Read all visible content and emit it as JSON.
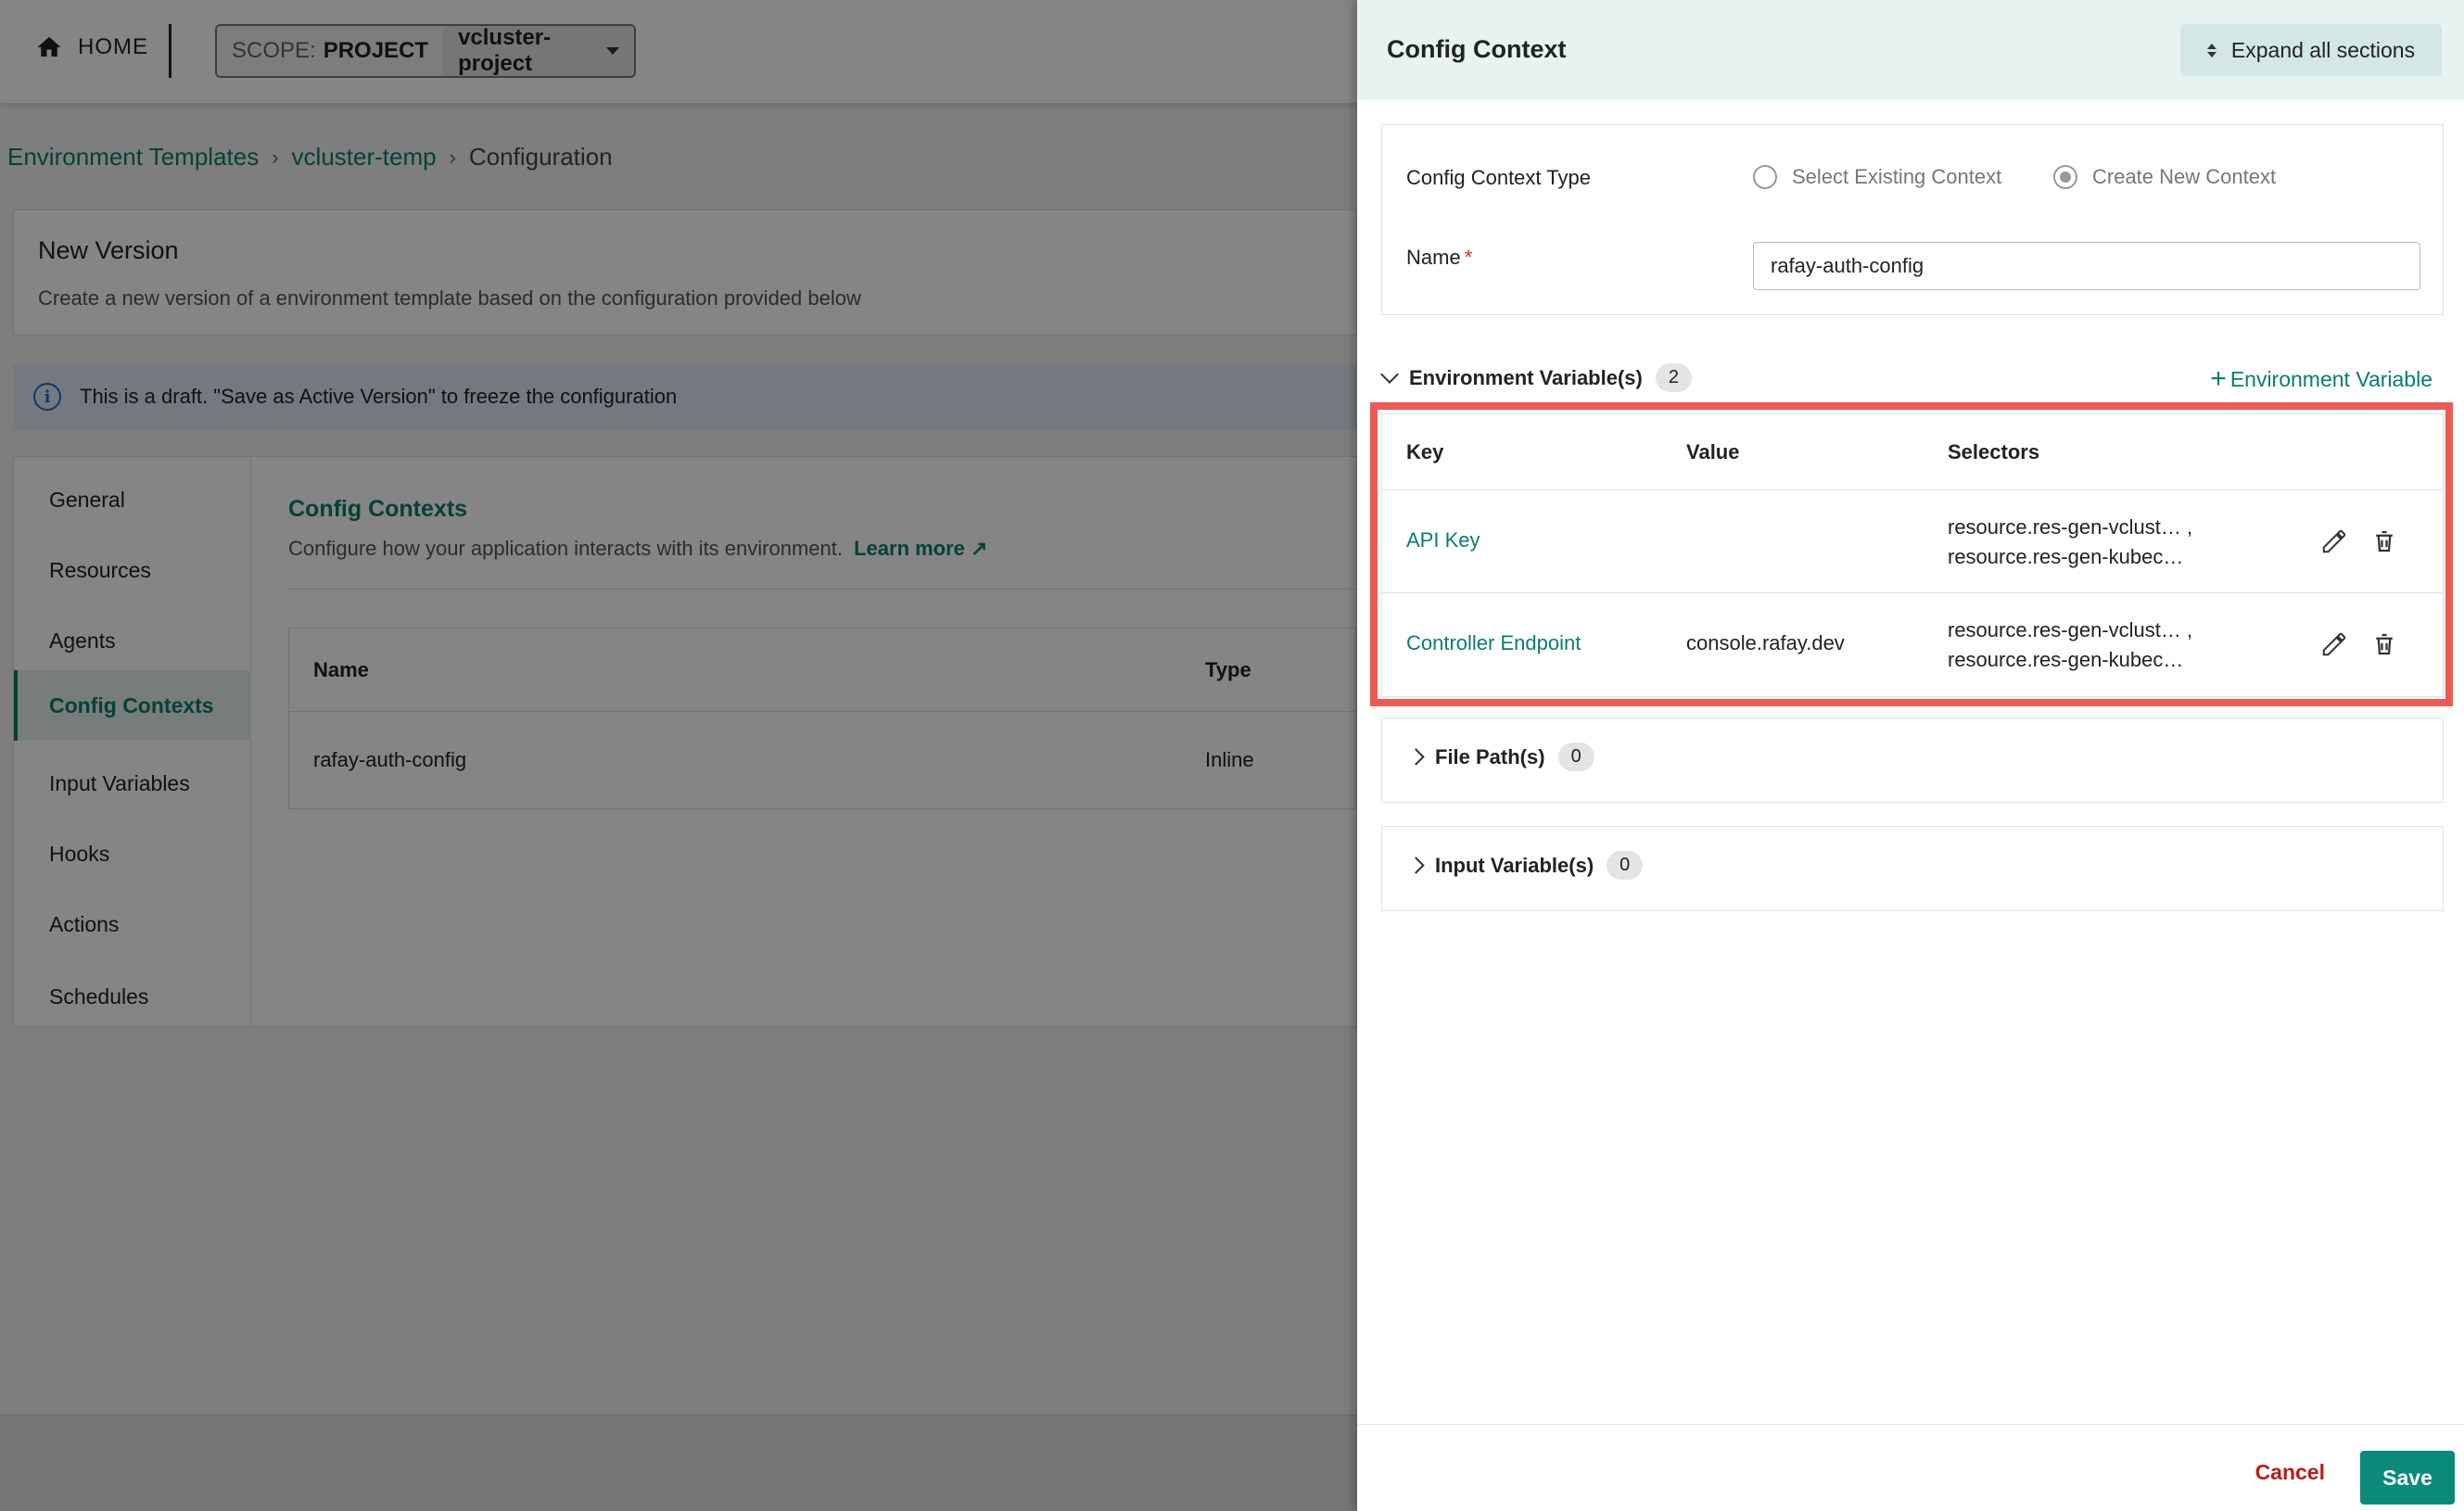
{
  "topbar": {
    "home_label": "HOME",
    "scope_label": "SCOPE:",
    "scope_value": "PROJECT",
    "project_name": "vcluster-project"
  },
  "breadcrumb": {
    "items": [
      "Environment Templates",
      "vcluster-temp",
      "Configuration"
    ],
    "separator": "›"
  },
  "version_card": {
    "title": "New Version",
    "subtitle": "Create a new version of a environment template based on the configuration provided below"
  },
  "banner": {
    "text": "This is a draft. \"Save as Active Version\" to freeze the configuration"
  },
  "config_nav": {
    "items": [
      "General",
      "Resources",
      "Agents",
      "Config Contexts",
      "Input Variables",
      "Hooks",
      "Actions",
      "Schedules"
    ],
    "active": "Config Contexts"
  },
  "config_main": {
    "title": "Config Contexts",
    "description": "Configure how your application interacts with its environment.",
    "learn_more": "Learn more",
    "table": {
      "headers": [
        "Name",
        "Type"
      ],
      "rows": [
        [
          "rafay-auth-config",
          "Inline"
        ]
      ]
    }
  },
  "drawer": {
    "title": "Config Context",
    "expand_label": "Expand all sections",
    "context_type_label": "Config Context Type",
    "radio_existing": "Select Existing Context",
    "radio_new": "Create New Context",
    "selected_radio": "Create New Context",
    "name_label": "Name",
    "required_mark": "*",
    "name_value": "rafay-auth-config",
    "env_section": {
      "label": "Environment Variable(s)",
      "count": "2",
      "add_label": "Environment Variable",
      "headers": {
        "key": "Key",
        "value": "Value",
        "selectors": "Selectors"
      },
      "rows": [
        {
          "key": "API Key",
          "value": "",
          "selectors": [
            "resource.res-gen-vclust… ,",
            "resource.res-gen-kubec…"
          ]
        },
        {
          "key": "Controller Endpoint",
          "value": "console.rafay.dev",
          "selectors": [
            "resource.res-gen-vclust… ,",
            "resource.res-gen-kubec…"
          ]
        }
      ]
    },
    "file_section": {
      "label": "File Path(s)",
      "count": "0"
    },
    "input_section": {
      "label": "Input Variable(s)",
      "count": "0"
    },
    "footer": {
      "cancel": "Cancel",
      "save": "Save"
    }
  },
  "colors": {
    "accent": "#0b7d6e",
    "highlight": "#ea5b55",
    "cancel": "#b71c1c",
    "save_bg": "#0b8a7a"
  }
}
